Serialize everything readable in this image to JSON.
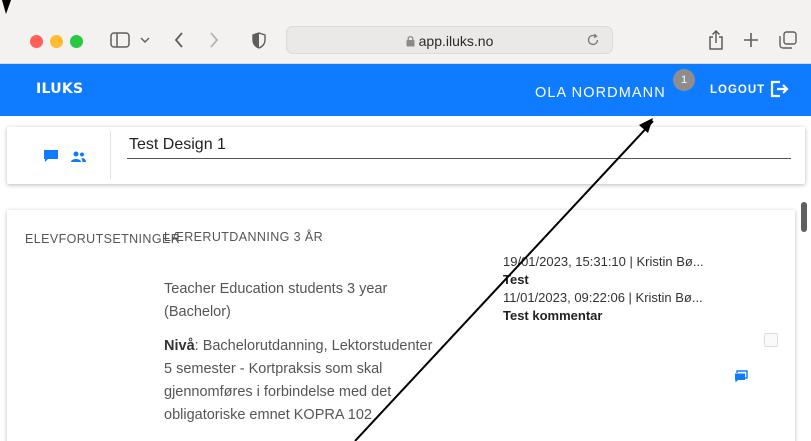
{
  "browser": {
    "url": "app.iluks.no"
  },
  "header": {
    "logo": "ILUKS",
    "username": "OLA NORDMANN",
    "notification_count": "1",
    "logout_label": "LOGOUT"
  },
  "design": {
    "title": "Test Design 1"
  },
  "section": {
    "label": "ELEVFORUTSETNINGER",
    "heading": "LÆRERUTDANNING 3 ÅR",
    "description": "Teacher Education students 3 year (Bachelor)",
    "level_label": "Nivå",
    "level_text": ": Bachelorutdanning, Lektorstudenter 5 semester - Kortpraksis som skal gjennomføres i forbindelse med det obligatoriske emnet KOPRA 102"
  },
  "comments": [
    {
      "meta": "19/01/2023, 15:31:10 | Kristin Bø...",
      "text": "Test"
    },
    {
      "meta": "11/01/2023, 09:22:06 | Kristin Bø...",
      "text": "Test kommentar"
    }
  ],
  "colors": {
    "brand_blue": "#0f7bff",
    "badge_gray": "#8d8d8d"
  }
}
